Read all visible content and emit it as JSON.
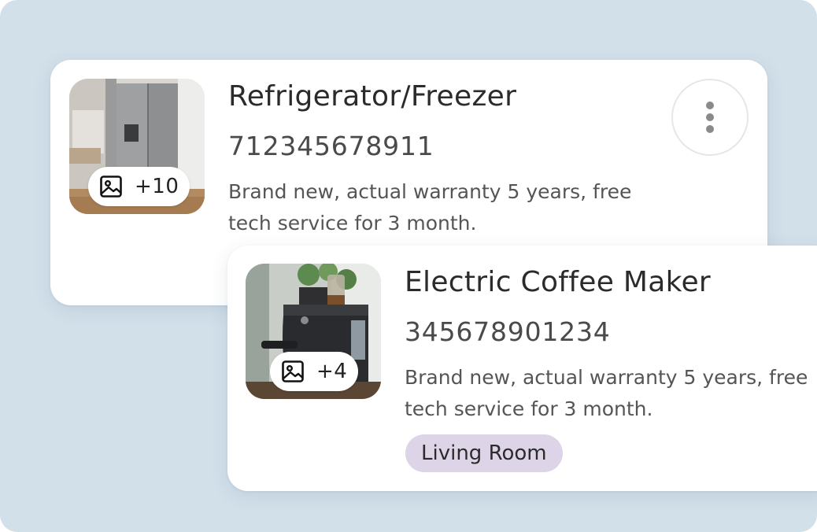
{
  "items": [
    {
      "title": "Refrigerator/Freezer",
      "code": "712345678911",
      "description": "Brand new, actual warranty 5 years, free tech service for 3 month.",
      "photo_count": "+10",
      "image_icon": "image-icon",
      "menu_icon": "more-vertical-icon"
    },
    {
      "title": "Electric Coffee Maker",
      "code": "345678901234",
      "description": "Brand new, actual warranty 5 years, free tech service for 3 month.",
      "photo_count": "+4",
      "image_icon": "image-icon",
      "tag": "Living Room"
    }
  ],
  "colors": {
    "background": "#d2e0ea",
    "card": "#ffffff",
    "tag_background": "#ddd4e8",
    "title_text": "#2b2b2b"
  }
}
